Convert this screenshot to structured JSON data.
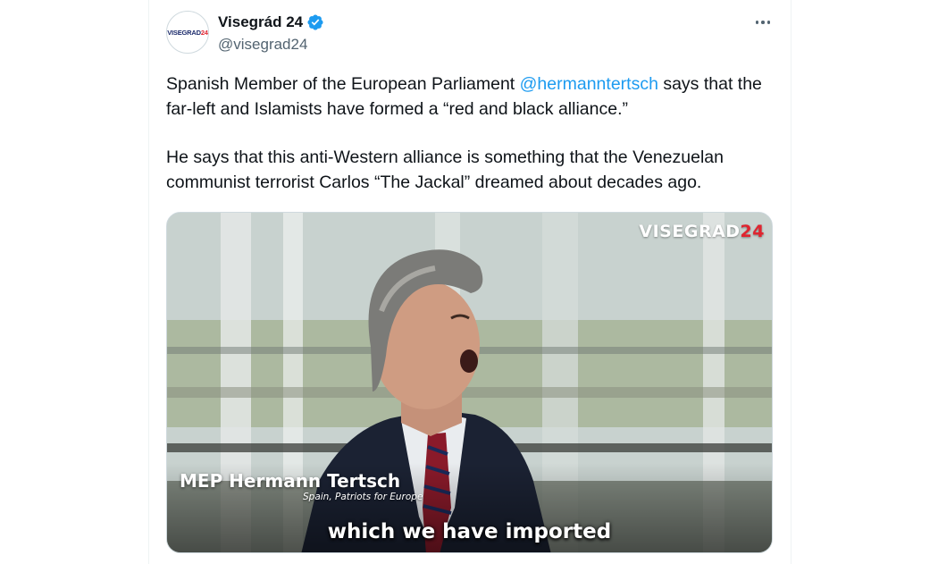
{
  "account": {
    "display_name": "Visegrád 24",
    "handle": "@visegrad24",
    "avatar_text": "VISEGRAD",
    "avatar_num": "24",
    "verified": true
  },
  "tweet": {
    "p1_before": "Spanish Member of the European Parliament ",
    "p1_mention": "@hermanntertsch",
    "p1_after": " says that the far-left and Islamists have formed a “red and black alliance.”",
    "p2": "He says that this anti-Western alliance is something that the Venezuelan communist terrorist Carlos “The Jackal” dreamed about decades ago."
  },
  "video": {
    "watermark_text": "VISEGRAD",
    "watermark_num": "24",
    "lower_third_name": "MEP Hermann Tertsch",
    "lower_third_sub": "Spain, Patriots for Europe",
    "subtitle": "which we have imported"
  },
  "colors": {
    "link": "#1d9bf0",
    "text": "#0f1419",
    "secondary": "#536471",
    "brand_red": "#e0242f",
    "brand_navy": "#1b2a6b"
  },
  "icons": [
    "verified-badge-icon",
    "more-options-icon"
  ]
}
